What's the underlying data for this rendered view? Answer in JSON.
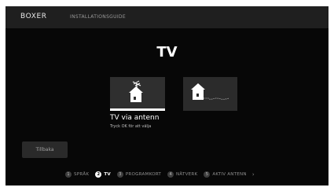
{
  "header": {
    "logo": "BOXER",
    "guide_title": "INSTALLATIONSGUIDE"
  },
  "page_title": "TV",
  "options": [
    {
      "icon": "house-antenna-icon",
      "selected": true
    },
    {
      "icon": "house-cable-icon",
      "selected": false
    }
  ],
  "selected_option": {
    "title": "TV via antenn",
    "hint": "Tryck OK för att välja"
  },
  "back_button": "Tillbaka",
  "steps": [
    {
      "number": "1",
      "label": "SPRÅK",
      "active": false
    },
    {
      "number": "2",
      "label": "TV",
      "active": true
    },
    {
      "number": "3",
      "label": "PROGRAMKORT",
      "active": false
    },
    {
      "number": "4",
      "label": "NÄTVERK",
      "active": false
    },
    {
      "number": "5",
      "label": "AKTIV ANTENN",
      "active": false
    }
  ],
  "next_chevron": "›"
}
